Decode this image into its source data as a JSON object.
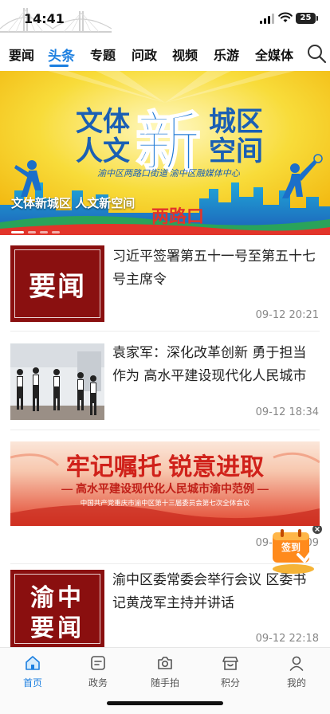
{
  "status_bar": {
    "time": "14:41",
    "battery": "25"
  },
  "nav_tabs": [
    {
      "label": "要闻",
      "active": false
    },
    {
      "label": "头条",
      "active": true
    },
    {
      "label": "专题",
      "active": false
    },
    {
      "label": "问政",
      "active": false
    },
    {
      "label": "视频",
      "active": false
    },
    {
      "label": "乐游",
      "active": false
    },
    {
      "label": "全媒体",
      "active": false
    }
  ],
  "banner": {
    "caption": "文体新城区 人文新空间",
    "art_line1": "文体",
    "art_line2": "人文",
    "art_big": "新",
    "art_right1": "城区",
    "art_right2": "空间",
    "art_sub": "渝中区两路口街道  渝中区融媒体中心",
    "art_bottom": "两路口",
    "slide_count": 4,
    "active_slide": 1
  },
  "news": [
    {
      "title": "习近平签署第五十一号至第五十七号主席令",
      "date": "09-12 20:21",
      "thumb_text": "要闻",
      "thumb_type": "tag"
    },
    {
      "title": "袁家军：深化改革创新 勇于担当作为 高水平建设现代化人民城市",
      "date": "09-12 18:34",
      "thumb_type": "photo"
    },
    {
      "banner_title": "牢记嘱托 锐意进取",
      "banner_subtitle": "— 高水平建设现代化人民城市渝中范例 —",
      "banner_small": "中国共产党重庆市渝中区第十三届委员会第七次全体会议",
      "date": "09-12 21:09"
    },
    {
      "title": "渝中区委常委会举行会议 区委书记黄茂军主持并讲话",
      "date": "09-12 22:18",
      "thumb_text_top": "渝中",
      "thumb_text_bottom": "要闻",
      "thumb_type": "tag2"
    }
  ],
  "signin": {
    "label": "签到"
  },
  "tabbar": [
    {
      "label": "首页",
      "icon": "home-icon",
      "active": true
    },
    {
      "label": "政务",
      "icon": "document-icon",
      "active": false
    },
    {
      "label": "随手拍",
      "icon": "camera-icon",
      "active": false
    },
    {
      "label": "积分",
      "icon": "shop-icon",
      "active": false
    },
    {
      "label": "我的",
      "icon": "user-icon",
      "active": false
    }
  ],
  "colors": {
    "accent": "#1c7fe0",
    "red": "#8a1010",
    "banner_yellow": "#f6d21a"
  }
}
